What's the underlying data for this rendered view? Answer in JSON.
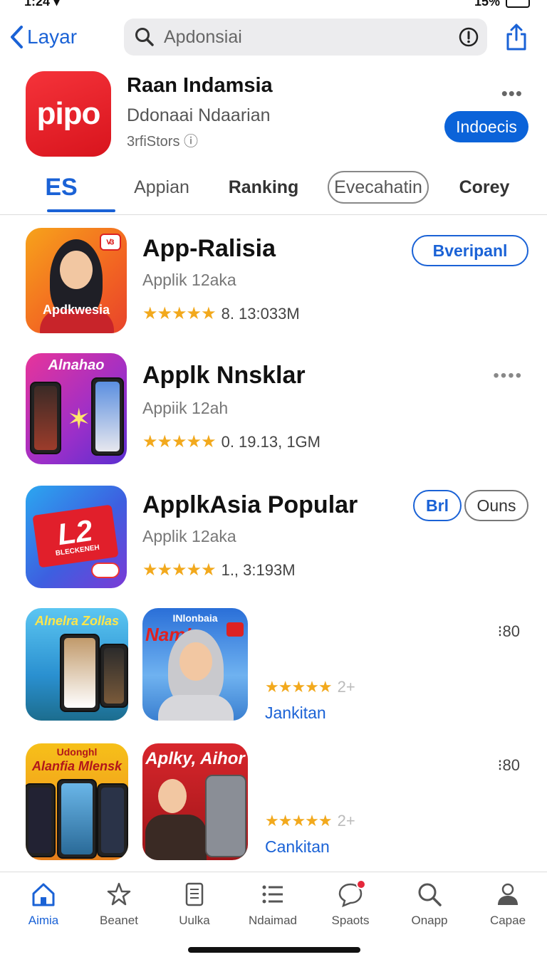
{
  "status": {
    "time": "1:24 ▾",
    "battery": "15%"
  },
  "nav": {
    "back_label": "Layar",
    "search_value": "Apdonsiai"
  },
  "header_app": {
    "icon_text": "pipo",
    "title": "Raan Indamsia",
    "subtitle": "Ddonaai Ndaarian",
    "store": "3rfiStors",
    "button": "Indoecis"
  },
  "tabs": [
    "ES",
    "Appian",
    "Ranking",
    "Evecahatin",
    "Corey"
  ],
  "apps": [
    {
      "name": "App-Ralisia",
      "sub": "Applik 12aka",
      "rating_value": 4.5,
      "stars": "★★★★★",
      "meta": "8. 13:033M",
      "icon_text": "Apdkwesia",
      "button": "Bveripanl"
    },
    {
      "name": "Applk Nnsklar",
      "sub": "Appiik 12ah",
      "rating_value": 4.5,
      "stars": "★★★★★",
      "meta": "0. 19.13, 1GM",
      "icon_text": "Alnahao"
    },
    {
      "name": "ApplkAsia Popular",
      "sub": "Applik 12aka",
      "rating_value": 4.5,
      "stars": "★★★★★",
      "meta": "1., 3:193M",
      "icon_text": "L2",
      "icon_banner": "BLECKENEH",
      "button1": "Brl",
      "button2": "Ouns"
    }
  ],
  "grid": [
    {
      "left_icon_text": "Alnelra Zollas",
      "right_icon_text": "INlonbaia",
      "right_icon_script": "Nam!",
      "stars": "★★★★★",
      "rating_suffix": "2+",
      "link": "Jankitan",
      "count": "⁝80"
    },
    {
      "left_icon_text": "Udonghl",
      "left_icon_text2": "Alanfia Mlensk",
      "right_icon_text": "Aplky, Aihor",
      "stars": "★★★★★",
      "rating_suffix": "2+",
      "link": "Cankitan",
      "count": "⁝80"
    }
  ],
  "tabbar": [
    {
      "label": "Aimia",
      "icon": "home-icon"
    },
    {
      "label": "Beanet",
      "icon": "star-badge-icon"
    },
    {
      "label": "Uulka",
      "icon": "document-icon"
    },
    {
      "label": "Ndaimad",
      "icon": "list-icon"
    },
    {
      "label": "Spaots",
      "icon": "chat-icon"
    },
    {
      "label": "Onapp",
      "icon": "search-icon"
    },
    {
      "label": "Capae",
      "icon": "person-icon"
    }
  ],
  "colors": {
    "accent": "#1a62d6",
    "star": "#f2a91d",
    "header_icon": "#e51f27"
  }
}
